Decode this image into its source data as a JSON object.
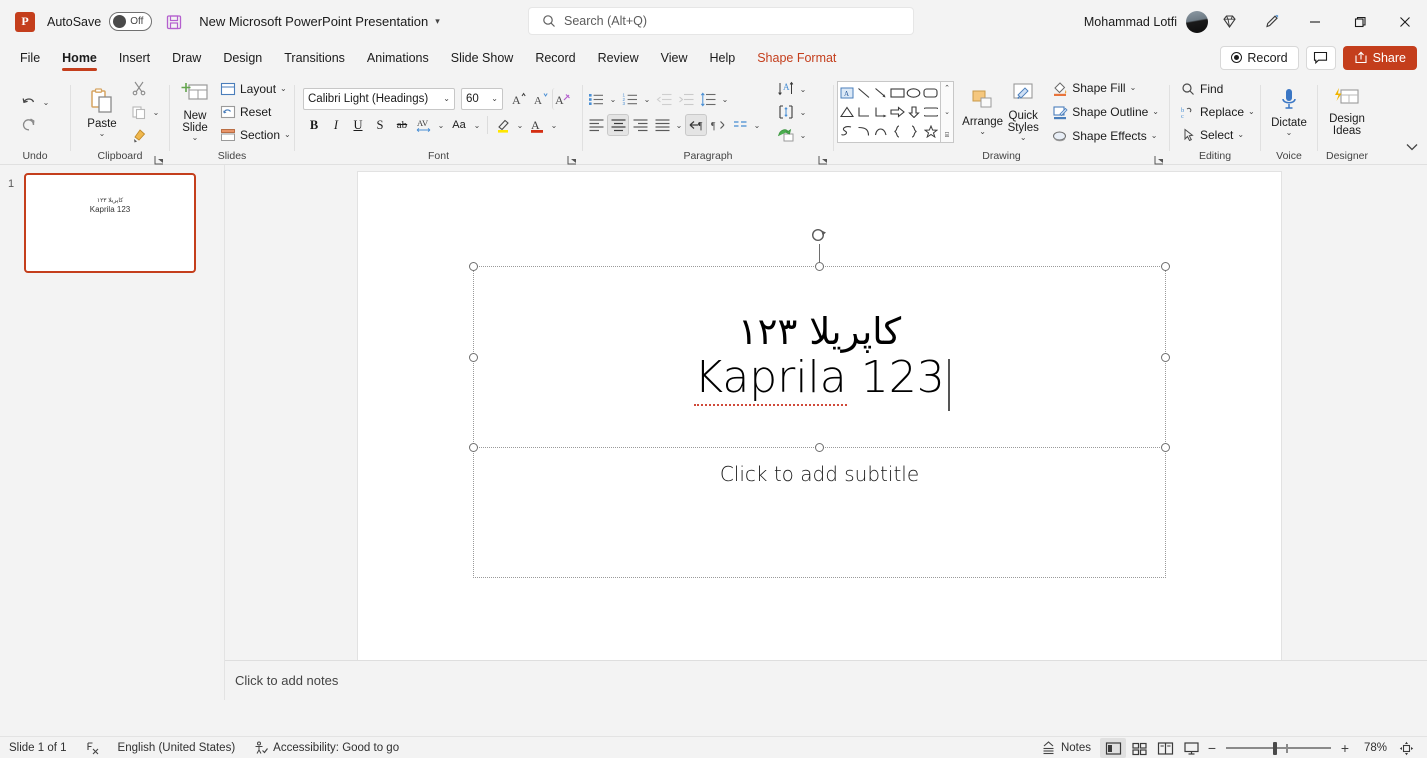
{
  "titlebar": {
    "app_logo": "powerpoint-logo",
    "autosave_label": "AutoSave",
    "autosave_state": "Off",
    "document_title": "New Microsoft PowerPoint Presentation",
    "caret": "▾",
    "username": "Mohammad Lotfi"
  },
  "search": {
    "placeholder": "Search (Alt+Q)",
    "value": ""
  },
  "tabs": [
    {
      "label": "File",
      "active": false
    },
    {
      "label": "Home",
      "active": true
    },
    {
      "label": "Insert",
      "active": false
    },
    {
      "label": "Draw",
      "active": false
    },
    {
      "label": "Design",
      "active": false
    },
    {
      "label": "Transitions",
      "active": false
    },
    {
      "label": "Animations",
      "active": false
    },
    {
      "label": "Slide Show",
      "active": false
    },
    {
      "label": "Record",
      "active": false
    },
    {
      "label": "Review",
      "active": false
    },
    {
      "label": "View",
      "active": false
    },
    {
      "label": "Help",
      "active": false
    },
    {
      "label": "Shape Format",
      "active": false,
      "contextual": true
    }
  ],
  "tabs_right": {
    "record_label": "Record",
    "share_label": "Share",
    "accent_color": "#c43e1c"
  },
  "ribbon": {
    "undo": {
      "label": "Undo",
      "undo_icon": "undo-arrow-icon",
      "redo_icon": "redo-arrow-icon"
    },
    "clipboard": {
      "label": "Clipboard",
      "paste_label": "Paste",
      "cut_label": "Cut",
      "copy_label": "Copy",
      "format_painter_label": "Format Painter"
    },
    "slides": {
      "label": "Slides",
      "new_slide_label": "New Slide",
      "layout_label": "Layout",
      "reset_label": "Reset",
      "section_label": "Section"
    },
    "font": {
      "label": "Font",
      "font_name": "Calibri Light (Headings)",
      "font_size": "60",
      "grow_label": "Increase Font Size",
      "shrink_label": "Decrease Font Size",
      "clear_label": "Clear All Formatting",
      "bold": "B",
      "italic": "I",
      "underline": "U",
      "shadow": "S",
      "strikethrough": "ab",
      "char_spacing": "AV",
      "change_case": "Aa",
      "highlight": "highlight-icon",
      "font_color": "A"
    },
    "paragraph": {
      "label": "Paragraph",
      "bullets": "bullets-icon",
      "numbering": "numbering-icon",
      "decrease_indent": "decrease-indent-icon",
      "increase_indent": "increase-indent-icon",
      "line_spacing": "line-spacing-icon",
      "align_left": "align-left-icon",
      "align_center": "align-center-icon",
      "align_right": "align-right-icon",
      "justify": "justify-icon",
      "rtl_direction": "rtl-text-direction-icon",
      "ltr_direction": "ltr-text-direction-icon",
      "columns": "columns-icon",
      "text_direction": "text-direction-icon",
      "align_text": "align-text-icon",
      "smartart": "convert-to-smartart-icon"
    },
    "drawing": {
      "label": "Drawing",
      "arrange_label": "Arrange",
      "quick_styles_label": "Quick Styles",
      "shape_fill_label": "Shape Fill",
      "shape_outline_label": "Shape Outline",
      "shape_effects_label": "Shape Effects",
      "shapes": [
        "textbox",
        "line",
        "arrow-line",
        "rectangle",
        "oval",
        "rounded-rectangle",
        "triangle",
        "elbow-connector",
        "elbow-arrow",
        "right-arrow",
        "down-arrow",
        "pentagon-tag",
        "scribble",
        "curve-down",
        "arc",
        "left-brace",
        "right-brace",
        "star"
      ]
    },
    "editing": {
      "label": "Editing",
      "find_label": "Find",
      "replace_label": "Replace",
      "select_label": "Select"
    },
    "voice": {
      "label": "Voice",
      "dictate_label": "Dictate"
    },
    "designer": {
      "label": "Designer",
      "design_ideas_label": "Design Ideas"
    },
    "collapse_icon": "chevron-down-icon"
  },
  "thumbnails": [
    {
      "number": "1",
      "arabic_line": "کاپریلا ۱۲۳",
      "latin_line": "Kaprila 123",
      "selected": true
    }
  ],
  "slide": {
    "title_placeholder": {
      "arabic_line": "کاپریلا ۱۲۳",
      "latin_line": "Kaprila 123",
      "selected": true,
      "has_cursor": true,
      "spell_error_word": "Kaprila"
    },
    "subtitle_placeholder": {
      "prompt": "Click to add subtitle",
      "selected": false
    }
  },
  "notes": {
    "prompt": "Click to add notes"
  },
  "statusbar": {
    "slide_count": "Slide 1 of 1",
    "accessibility_icon": "accessibility-checker-icon",
    "language": "English (United States)",
    "accessibility": "Accessibility: Good to go",
    "notes_label": "Notes",
    "views": [
      {
        "name": "normal-view",
        "active": true
      },
      {
        "name": "slide-sorter-view",
        "active": false
      },
      {
        "name": "reading-view",
        "active": false
      },
      {
        "name": "slide-show-view",
        "active": false
      }
    ],
    "zoom_out": "−",
    "zoom_in": "+",
    "zoom_level": "78%",
    "fit_slide_icon": "fit-slide-to-window-icon"
  }
}
